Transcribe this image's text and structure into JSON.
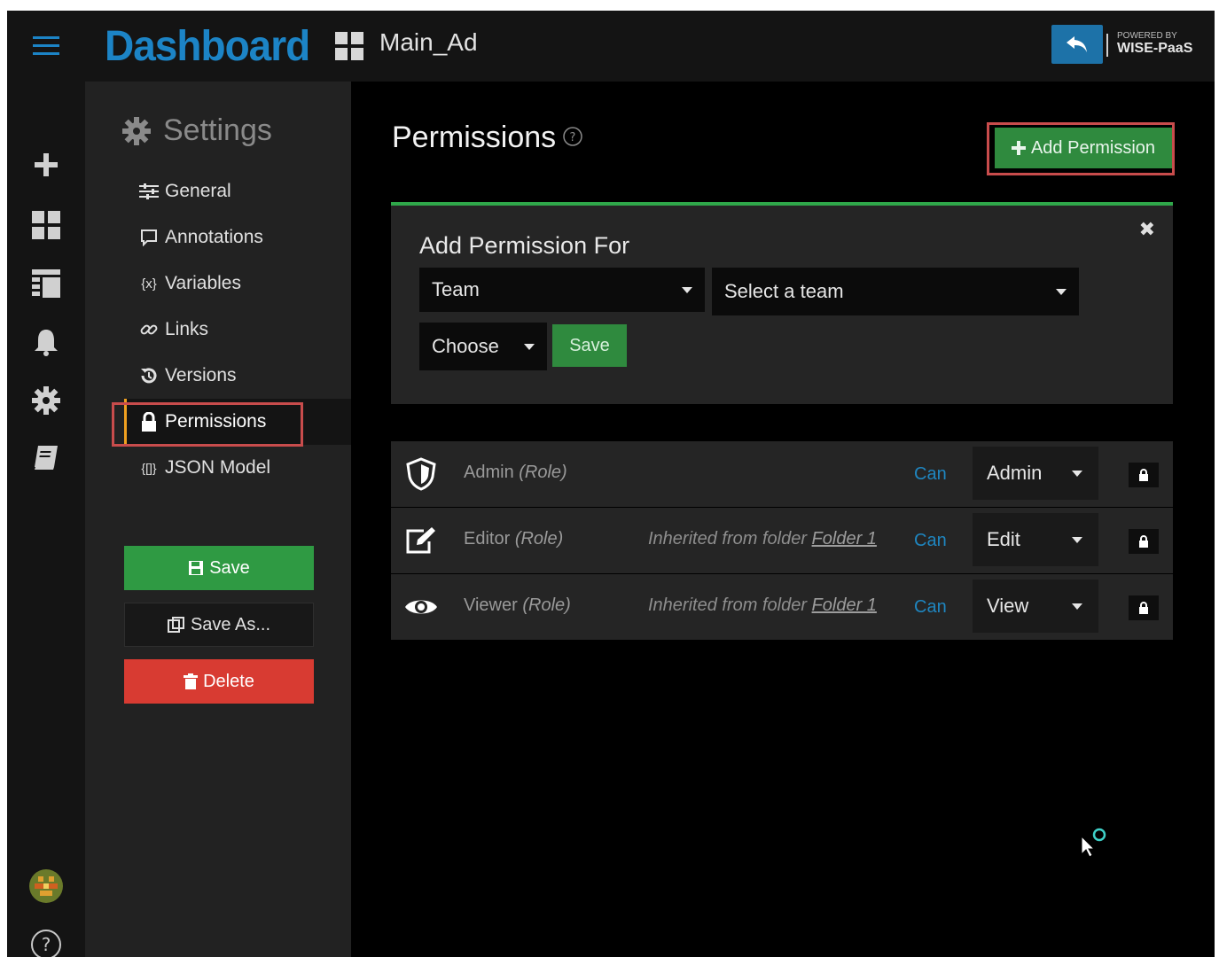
{
  "topbar": {
    "brand": "Dashboard",
    "dashboard_name": "Main_Ad",
    "powered_by": "POWERED BY",
    "wise_paas": "WISE-PaaS"
  },
  "rail": {
    "icons": [
      "menu-icon",
      "plus-icon",
      "dashboards-icon",
      "layout-icon",
      "bell-icon",
      "gear-icon",
      "book-icon",
      "avatar",
      "help-icon"
    ]
  },
  "sidebar": {
    "title": "Settings",
    "items": [
      {
        "label": "General",
        "icon": "sliders-icon"
      },
      {
        "label": "Annotations",
        "icon": "comment-icon"
      },
      {
        "label": "Variables",
        "icon": "variable-icon"
      },
      {
        "label": "Links",
        "icon": "link-icon"
      },
      {
        "label": "Versions",
        "icon": "history-icon"
      },
      {
        "label": "Permissions",
        "icon": "lock-icon",
        "active": true
      },
      {
        "label": "JSON Model",
        "icon": "json-icon"
      }
    ],
    "save_label": "Save",
    "save_as_label": "Save As...",
    "delete_label": "Delete"
  },
  "main": {
    "title": "Permissions",
    "add_permission_label": "Add Permission",
    "panel": {
      "title": "Add Permission For",
      "type_select": "Team",
      "team_select": "Select a team",
      "level_select": "Choose",
      "save_label": "Save"
    },
    "rows": [
      {
        "name": "Admin",
        "role": "(Role)",
        "inherited_text": "",
        "folder": "",
        "can": "Can",
        "level": "Admin",
        "icon": "shield-icon"
      },
      {
        "name": "Editor",
        "role": "(Role)",
        "inherited_text": "Inherited from folder",
        "folder": "Folder 1",
        "can": "Can",
        "level": "Edit",
        "icon": "edit-icon"
      },
      {
        "name": "Viewer",
        "role": "(Role)",
        "inherited_text": "Inherited from folder",
        "folder": "Folder 1",
        "can": "Can",
        "level": "View",
        "icon": "eye-icon"
      }
    ]
  },
  "colors": {
    "brand_blue": "#1c84c6",
    "green": "#2f8a3e",
    "red": "#d83b32",
    "highlight": "#c84c4c",
    "can_blue": "#1f86c0"
  }
}
